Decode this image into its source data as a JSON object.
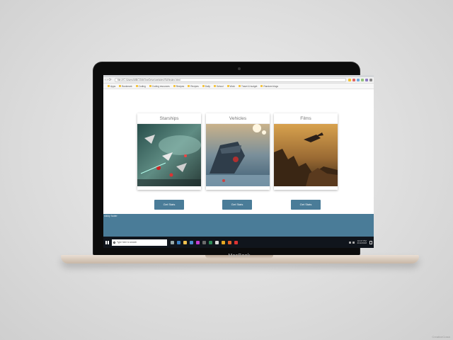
{
  "browser": {
    "url": "file:///C:/Users/MBCGM/OneDrive/webdev/SW/index.html",
    "bookmarks": [
      "Apps",
      "Bookmark",
      "Coding",
      "Coding resources",
      "Recipes",
      "Recipes",
      "Daily",
      "School",
      "Work",
      "Travel & budget",
      "Random blogs"
    ]
  },
  "cards": [
    {
      "title": "Starships",
      "button": "Get Stats"
    },
    {
      "title": "Vehicles",
      "button": "Get Stats"
    },
    {
      "title": "Films",
      "button": "Get Stats"
    }
  ],
  "footer": {
    "text": "sticky footer"
  },
  "taskbar": {
    "search_placeholder": "Type here to search",
    "time": "10:07 PM",
    "date": "4/13/2018"
  },
  "device": {
    "brand": "MacBook"
  },
  "credit": "CreativeCrash",
  "colors": {
    "accent": "#4a7c98",
    "taskbar": "#10151c"
  },
  "icons": [
    "windows-start-icon",
    "search-icon",
    "task-view-icon",
    "edge-icon",
    "file-explorer-icon",
    "store-icon",
    "chrome-icon",
    "firefox-icon"
  ]
}
